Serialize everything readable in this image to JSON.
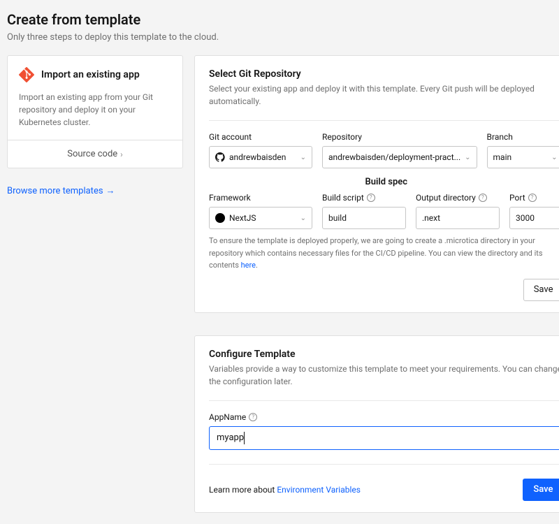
{
  "header": {
    "title": "Create from template",
    "subtitle": "Only three steps to deploy this template to the cloud."
  },
  "left": {
    "import_title": "Import an existing app",
    "import_desc": "Import an existing app from your Git repository and deploy it on your Kubernetes cluster.",
    "source_code": "Source code",
    "browse": "Browse more templates"
  },
  "repo_panel": {
    "title": "Select Git Repository",
    "subtitle": "Select your existing app and deploy it with this template. Every Git push will be deployed automatically.",
    "git_account_label": "Git account",
    "git_account_value": "andrewbaisden",
    "repository_label": "Repository",
    "repository_value": "andrewbaisden/deployment-pract...",
    "branch_label": "Branch",
    "branch_value": "main",
    "build_spec": "Build spec",
    "framework_label": "Framework",
    "framework_value": "NextJS",
    "build_script_label": "Build script",
    "build_script_value": "build",
    "output_dir_label": "Output directory",
    "output_dir_value": ".next",
    "port_label": "Port",
    "port_value": "3000",
    "note_pre": "To ensure the template is deployed properly, we are going to create a .microtica directory in your repository which contains necessary files for the CI/CD pipeline. You can view the directory and its contents ",
    "note_link": "here",
    "note_post": ".",
    "save": "Save"
  },
  "config_panel": {
    "title": "Configure Template",
    "subtitle": "Variables provide a way to customize this template to meet your requirements. You can change the configuration later.",
    "appname_label": "AppName",
    "appname_value": "myapp",
    "learn_pre": "Learn more about ",
    "learn_link": "Environment Variables",
    "save": "Save"
  }
}
